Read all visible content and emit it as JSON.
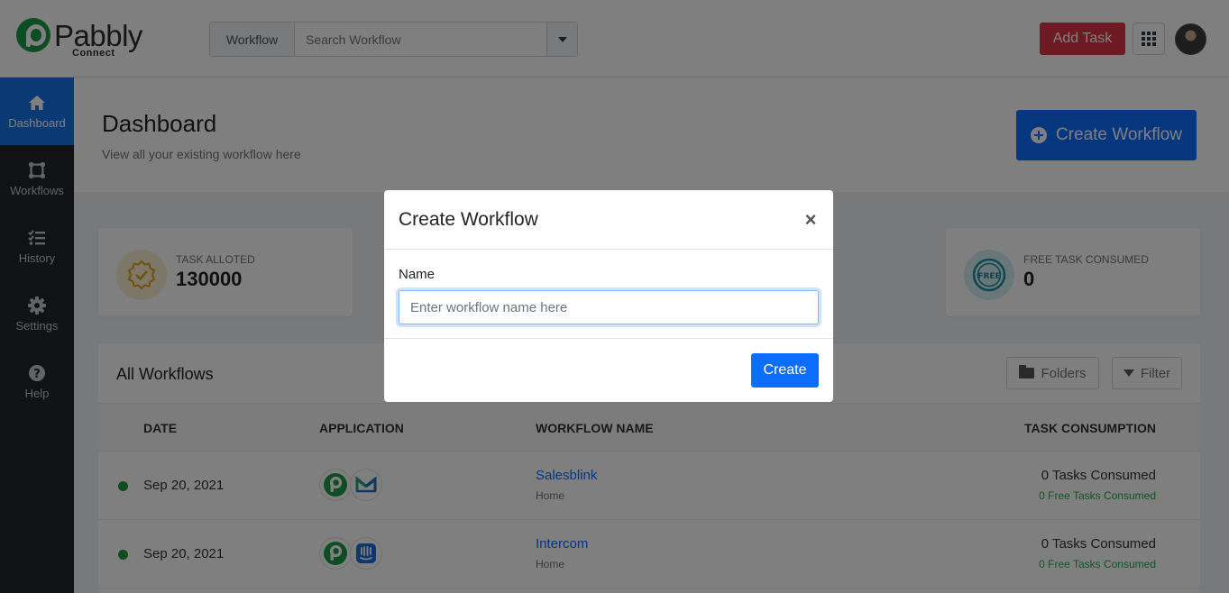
{
  "brand": {
    "name": "Pabbly",
    "sub": "Connect"
  },
  "search": {
    "scope_label": "Workflow",
    "placeholder": "Search Workflow"
  },
  "header": {
    "add_task_label": "Add Task"
  },
  "sidebar": {
    "items": [
      {
        "label": "Dashboard",
        "icon": "home-icon",
        "active": true
      },
      {
        "label": "Workflows",
        "icon": "workflow-icon",
        "active": false
      },
      {
        "label": "History",
        "icon": "history-icon",
        "active": false
      },
      {
        "label": "Settings",
        "icon": "gear-icon",
        "active": false
      },
      {
        "label": "Help",
        "icon": "help-icon",
        "active": false
      }
    ]
  },
  "page": {
    "title": "Dashboard",
    "subtitle": "View all your existing workflow here",
    "create_workflow_label": "Create Workflow"
  },
  "stats": [
    {
      "label": "TASK ALLOTED",
      "value": "130000",
      "icon": "badge-check-icon"
    },
    {
      "label": "FREE TASK CONSUMED",
      "value": "0",
      "icon": "free-stamp-icon"
    }
  ],
  "workflows": {
    "title": "All Workflows",
    "folders_label": "Folders",
    "filter_label": "Filter",
    "columns": [
      "DATE",
      "APPLICATION",
      "WORKFLOW NAME",
      "TASK CONSUMPTION"
    ],
    "rows": [
      {
        "date": "Sep 20, 2021",
        "apps": [
          "pabbly-app-icon",
          "mail-app-icon"
        ],
        "name": "Salesblink",
        "folder": "Home",
        "tasks": "0 Tasks Consumed",
        "free_tasks": "0 Free Tasks Consumed"
      },
      {
        "date": "Sep 20, 2021",
        "apps": [
          "pabbly-app-icon",
          "intercom-app-icon"
        ],
        "name": "Intercom",
        "folder": "Home",
        "tasks": "0 Tasks Consumed",
        "free_tasks": "0 Free Tasks Consumed"
      }
    ]
  },
  "modal": {
    "title": "Create Workflow",
    "close_symbol": "×",
    "name_label": "Name",
    "name_placeholder": "Enter workflow name here",
    "name_value": "",
    "create_label": "Create"
  },
  "colors": {
    "primary": "#0d6efd",
    "danger": "#dc3545",
    "brand_green": "#1a9b47",
    "sidebar_bg": "#212529",
    "sidebar_active": "#1673e6",
    "status_active": "#1e9b3e"
  }
}
